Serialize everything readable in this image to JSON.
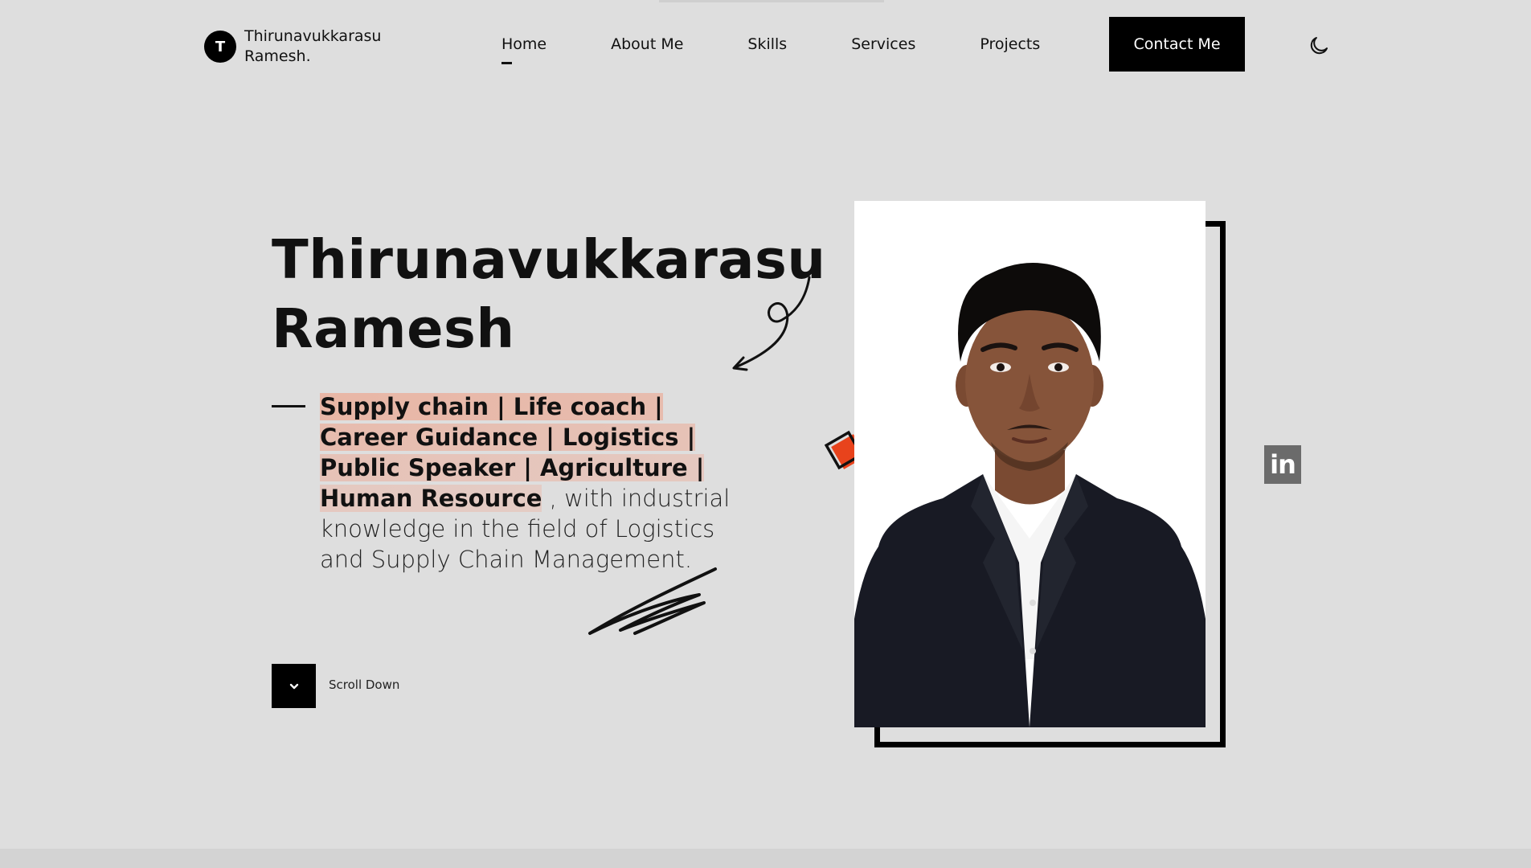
{
  "header": {
    "logo_letter": "T",
    "logo_line1": "Thirunavukkarasu",
    "logo_line2": "Ramesh.",
    "nav": [
      {
        "label": "Home",
        "active": true
      },
      {
        "label": "About Me"
      },
      {
        "label": "Skills"
      },
      {
        "label": "Services"
      },
      {
        "label": "Projects"
      }
    ],
    "contact_label": "Contact Me",
    "theme_icon": "moon-icon"
  },
  "hero": {
    "name_line1": "Thirunavukkarasu",
    "name_line2": "Ramesh",
    "highlight": "Supply chain | Life coach | Career Guidance | Logistics | Public Speaker | Agriculture | Human Resource",
    "description": " , with industrial knowledge in the field of Logistics and Supply Chain Management.",
    "scroll_label": "Scroll Down"
  },
  "social": {
    "linkedin_label": "in"
  },
  "colors": {
    "background": "#dedede",
    "accent": "#e8431c",
    "highlight": "#f09678",
    "black": "#000000"
  }
}
